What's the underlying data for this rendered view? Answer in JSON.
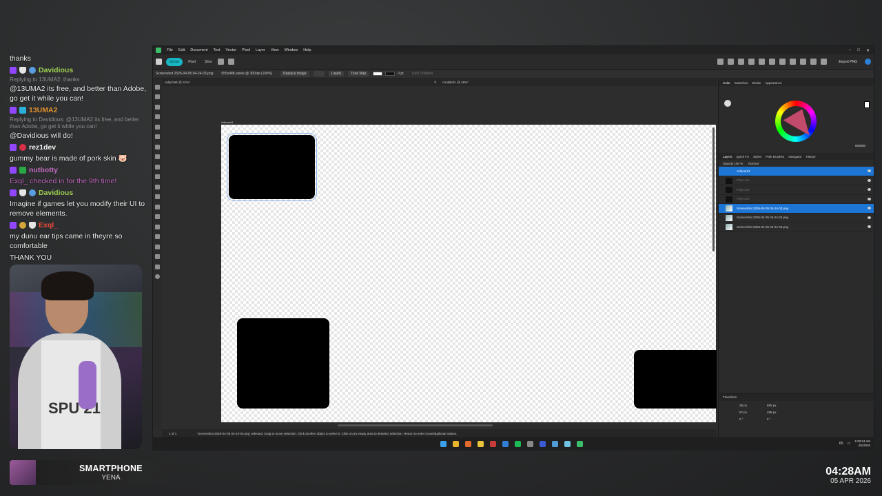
{
  "chat": {
    "messages": [
      {
        "type": "text",
        "text": "thanks"
      },
      {
        "type": "user",
        "user": "Davidious",
        "color": "#9ccf52",
        "badges": [
          "twitch",
          "shield",
          "gear"
        ]
      },
      {
        "type": "reply",
        "text": "Replying to 13UMA2: thanks"
      },
      {
        "type": "text",
        "text": "@13UMA2 its free, and better than Adobe, go get it while you can!"
      },
      {
        "type": "user",
        "user": "13UMA2",
        "color": "#e0912f",
        "badges": [
          "twitch",
          "mod"
        ]
      },
      {
        "type": "reply",
        "text": "Replying to Davidious: @13UMA2 its free, and better than Adobe, go get it while you can!"
      },
      {
        "type": "text",
        "text": "@Davidious will do!"
      },
      {
        "type": "user",
        "user": "rez1dev",
        "color": "#f2f2f2",
        "badges": [
          "twitch",
          "heart"
        ]
      },
      {
        "type": "text",
        "text": "gummy bear is made of pork skin 🐷"
      },
      {
        "type": "user",
        "user": "nutbotty",
        "color": "#c46cc2",
        "badges": [
          "twitch",
          "check"
        ]
      },
      {
        "type": "sys",
        "text": "Exql_ checked in for the 9th time!"
      },
      {
        "type": "user",
        "user": "Davidious",
        "color": "#9ccf52",
        "badges": [
          "twitch",
          "shield",
          "gear"
        ]
      },
      {
        "type": "text",
        "text": "Imagine if games let you modify their UI to remove elements."
      },
      {
        "type": "user",
        "user": "Exql_",
        "color": "#ef4a3a",
        "badges": [
          "twitch",
          "star",
          "shield"
        ]
      },
      {
        "type": "text",
        "text": "my dunu ear tips came in theyre so comfortable"
      },
      {
        "type": "text",
        "text": "THANK YOU"
      }
    ]
  },
  "webcam": {
    "shirt_text": "SPU 21"
  },
  "now_playing": {
    "title": "SMARTPHONE",
    "artist": "YENA"
  },
  "clock": {
    "time": "04:28AM",
    "date": "05 APR 2026"
  },
  "app": {
    "menus": [
      "File",
      "Edit",
      "Document",
      "Text",
      "Vector",
      "Pixel",
      "Layer",
      "View",
      "Window",
      "Help"
    ],
    "personas": [
      "Vector",
      "Pixel",
      "Slice"
    ],
    "export_label": "Export PNG",
    "context": {
      "filename": "Screenshot 2026-04-05 04-24-03.png",
      "dimensions": "655x488 pixels @ 300dpi (100%)",
      "replace": "Replace image",
      "buttons": [
        "Liquify",
        "Tone Map"
      ],
      "stroke": "0 pt",
      "lock": "Lock Children"
    },
    "doc_tabs": [
      "nullyONE @ 31%*",
      "<Untitled> @ 49%*"
    ],
    "artboard_label": "Artboard1",
    "status": {
      "page": "1 of 1",
      "text": "'Screenshot 2026-04-05 04-24-03.png' selected. Drag to move selection. Click another object to select it. Click on an empty area to deselect selection. Return to enter move/duplicate values."
    },
    "color_tabs": [
      "Color",
      "Swatches",
      "Stroke",
      "Appearance"
    ],
    "color_hex": "000000",
    "layer_tabs": [
      "Layers",
      "Quick FX",
      "Styles",
      "Path Brushes",
      "Navigator",
      "History"
    ],
    "opacity": "Opacity  100 %",
    "blend": "Normal",
    "layers": [
      {
        "name": "Artboard1",
        "state": "sel",
        "thumb": "none"
      },
      {
        "name": "Poly Line",
        "state": "dim",
        "thumb": "dark"
      },
      {
        "name": "Poly Line",
        "state": "dim",
        "thumb": "dark"
      },
      {
        "name": "Poly Line",
        "state": "dim",
        "thumb": "dark"
      },
      {
        "name": "Screenshot 2026-04-05 04-24-03.png",
        "state": "sel",
        "thumb": "img"
      },
      {
        "name": "Screenshot 2026-04-05 04-24-03.png",
        "state": "",
        "thumb": "img"
      },
      {
        "name": "Screenshot 2026-04-05 04-24-03.png",
        "state": "",
        "thumb": "img"
      }
    ],
    "transform": {
      "title": "Transform",
      "x": "38 px",
      "y": "67 px",
      "w": "655 px",
      "h": "488 px",
      "r": "0 °",
      "s": "0 °"
    }
  },
  "taskbar": {
    "icons": [
      {
        "name": "windows-start",
        "color": "#3aa0ea"
      },
      {
        "name": "chrome",
        "color": "#e8b62c"
      },
      {
        "name": "firefox",
        "color": "#e26a2c"
      },
      {
        "name": "explorer",
        "color": "#e8c33c"
      },
      {
        "name": "steam",
        "color": "#c93b3b"
      },
      {
        "name": "vscode",
        "color": "#2f7fd6"
      },
      {
        "name": "spotify",
        "color": "#1db954"
      },
      {
        "name": "app-a",
        "color": "#888888"
      },
      {
        "name": "app-b",
        "color": "#3b5bd6"
      },
      {
        "name": "app-c",
        "color": "#4f9dd6"
      },
      {
        "name": "notepad",
        "color": "#6fc3e0"
      },
      {
        "name": "affinity",
        "color": "#3bbd6a"
      }
    ],
    "tray_num": "65",
    "tray_time": "4:28:34 AM",
    "tray_date": "4/5/2026"
  }
}
